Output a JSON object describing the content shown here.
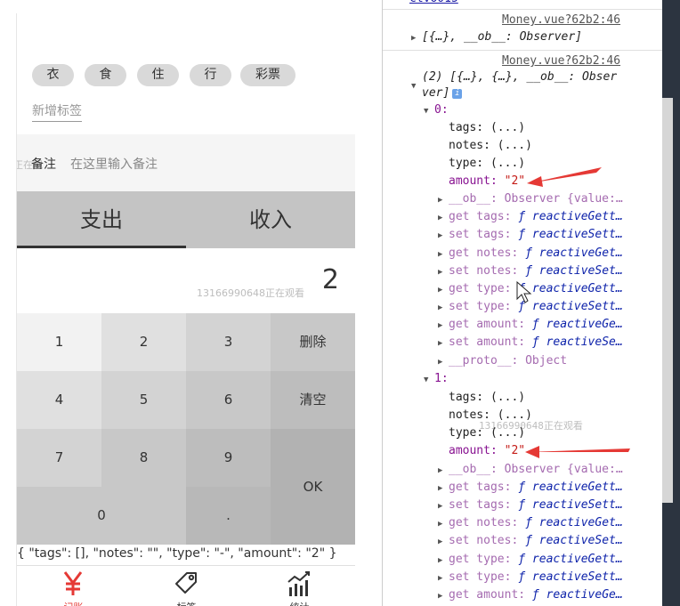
{
  "app": {
    "tags": [
      "衣",
      "食",
      "住",
      "行",
      "彩票"
    ],
    "new_tag_label": "新增标签",
    "notes_label": "备注",
    "notes_placeholder": "在这里输入备注",
    "type_tabs": [
      "支出",
      "收入"
    ],
    "selected_type": "支出",
    "amount_display": "2",
    "keypad": {
      "k1": "1",
      "k2": "2",
      "k3": "3",
      "delete": "删除",
      "k4": "4",
      "k5": "5",
      "k6": "6",
      "clear": "清空",
      "k7": "7",
      "k8": "8",
      "k9": "9",
      "ok": "OK",
      "k0": "0",
      "dot": "."
    },
    "record_json": "{ \"tags\": [], \"notes\": \"\", \"type\": \"-\", \"amount\": \"2\" }",
    "nav": {
      "record_label": "记账",
      "tags_label": "标签",
      "stats_label": "统计"
    },
    "watermark_text": "13166990648正在观看",
    "watermark_edge": "正在观"
  },
  "devtools": {
    "top_cut": "ctvo015",
    "msg1": {
      "source": "Money.vue?62b2:46",
      "summary": "[{…}, __ob__: Observer]"
    },
    "msg2": {
      "source": "Money.vue?62b2:46",
      "summary_line1": "(2) [{…}, {…}, __ob__: Obser",
      "summary_line2": "ver]",
      "items": [
        {
          "index": "0:",
          "tags": "tags: (...)",
          "notes": "notes: (...)",
          "type": "type: (...)",
          "amount_key": "amount:",
          "amount_val": "\"2\"",
          "ob": "__ob__: Observer {value:…",
          "get_tags": "get tags:",
          "set_tags": "set tags:",
          "get_notes": "get notes:",
          "set_notes": "set notes:",
          "get_type": "get type:",
          "set_type": "set type:",
          "get_amount": "get amount:",
          "set_amount": "set amount:",
          "proto": "__proto__: Object"
        },
        {
          "index": "1:",
          "tags": "tags: (...)",
          "notes": "notes: (...)",
          "type": "type: (...)",
          "amount_key": "amount:",
          "amount_val": "\"2\"",
          "ob": "__ob__: Observer {value:…",
          "get_tags": "get tags:",
          "set_tags": "set tags:",
          "get_notes": "get notes:",
          "set_notes": "set notes:",
          "get_type": "get type:",
          "set_type": "set type:",
          "get_amount": "get amount:"
        }
      ],
      "fn_reactive_getter": "ƒ reactiveGett…",
      "fn_reactive_setter": "ƒ reactiveSett…",
      "fn_getter_short": "ƒ reactiveGet…",
      "fn_setter_short": "ƒ reactiveSet…",
      "fn_getter_xs": "ƒ reactiveGe…",
      "fn_setter_xs": "ƒ reactiveSe…"
    }
  },
  "colors": {
    "tag_bg": "#d9d9d9",
    "type_bar_bg": "#c4c4c4",
    "accent_red": "#e53935",
    "key_shades": [
      "#f2f2f2",
      "#e0e0e0",
      "#d3d3d3",
      "#c8c8c8",
      "#bdbdbd"
    ]
  }
}
